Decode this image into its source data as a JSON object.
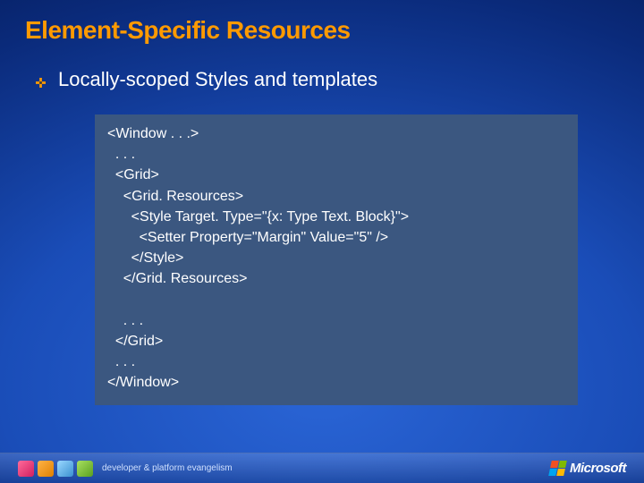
{
  "title": "Element-Specific Resources",
  "bullet": "Locally-scoped Styles and templates",
  "code": {
    "l1": "<Window . . .>",
    "l2": "  . . .",
    "l3": "  <Grid>",
    "l4": "    <Grid. Resources>",
    "l5": "      <Style Target. Type=\"{x: Type Text. Block}\">",
    "l6": "        <Setter Property=\"Margin\" Value=\"5\" />",
    "l7": "      </Style>",
    "l8": "    </Grid. Resources>",
    "l9": "",
    "l10": "    . . .",
    "l11": "  </Grid>",
    "l12": "  . . .",
    "l13": "</Window>"
  },
  "footer": {
    "left_text": "developer & platform evangelism",
    "logo_text": "Microsoft"
  }
}
